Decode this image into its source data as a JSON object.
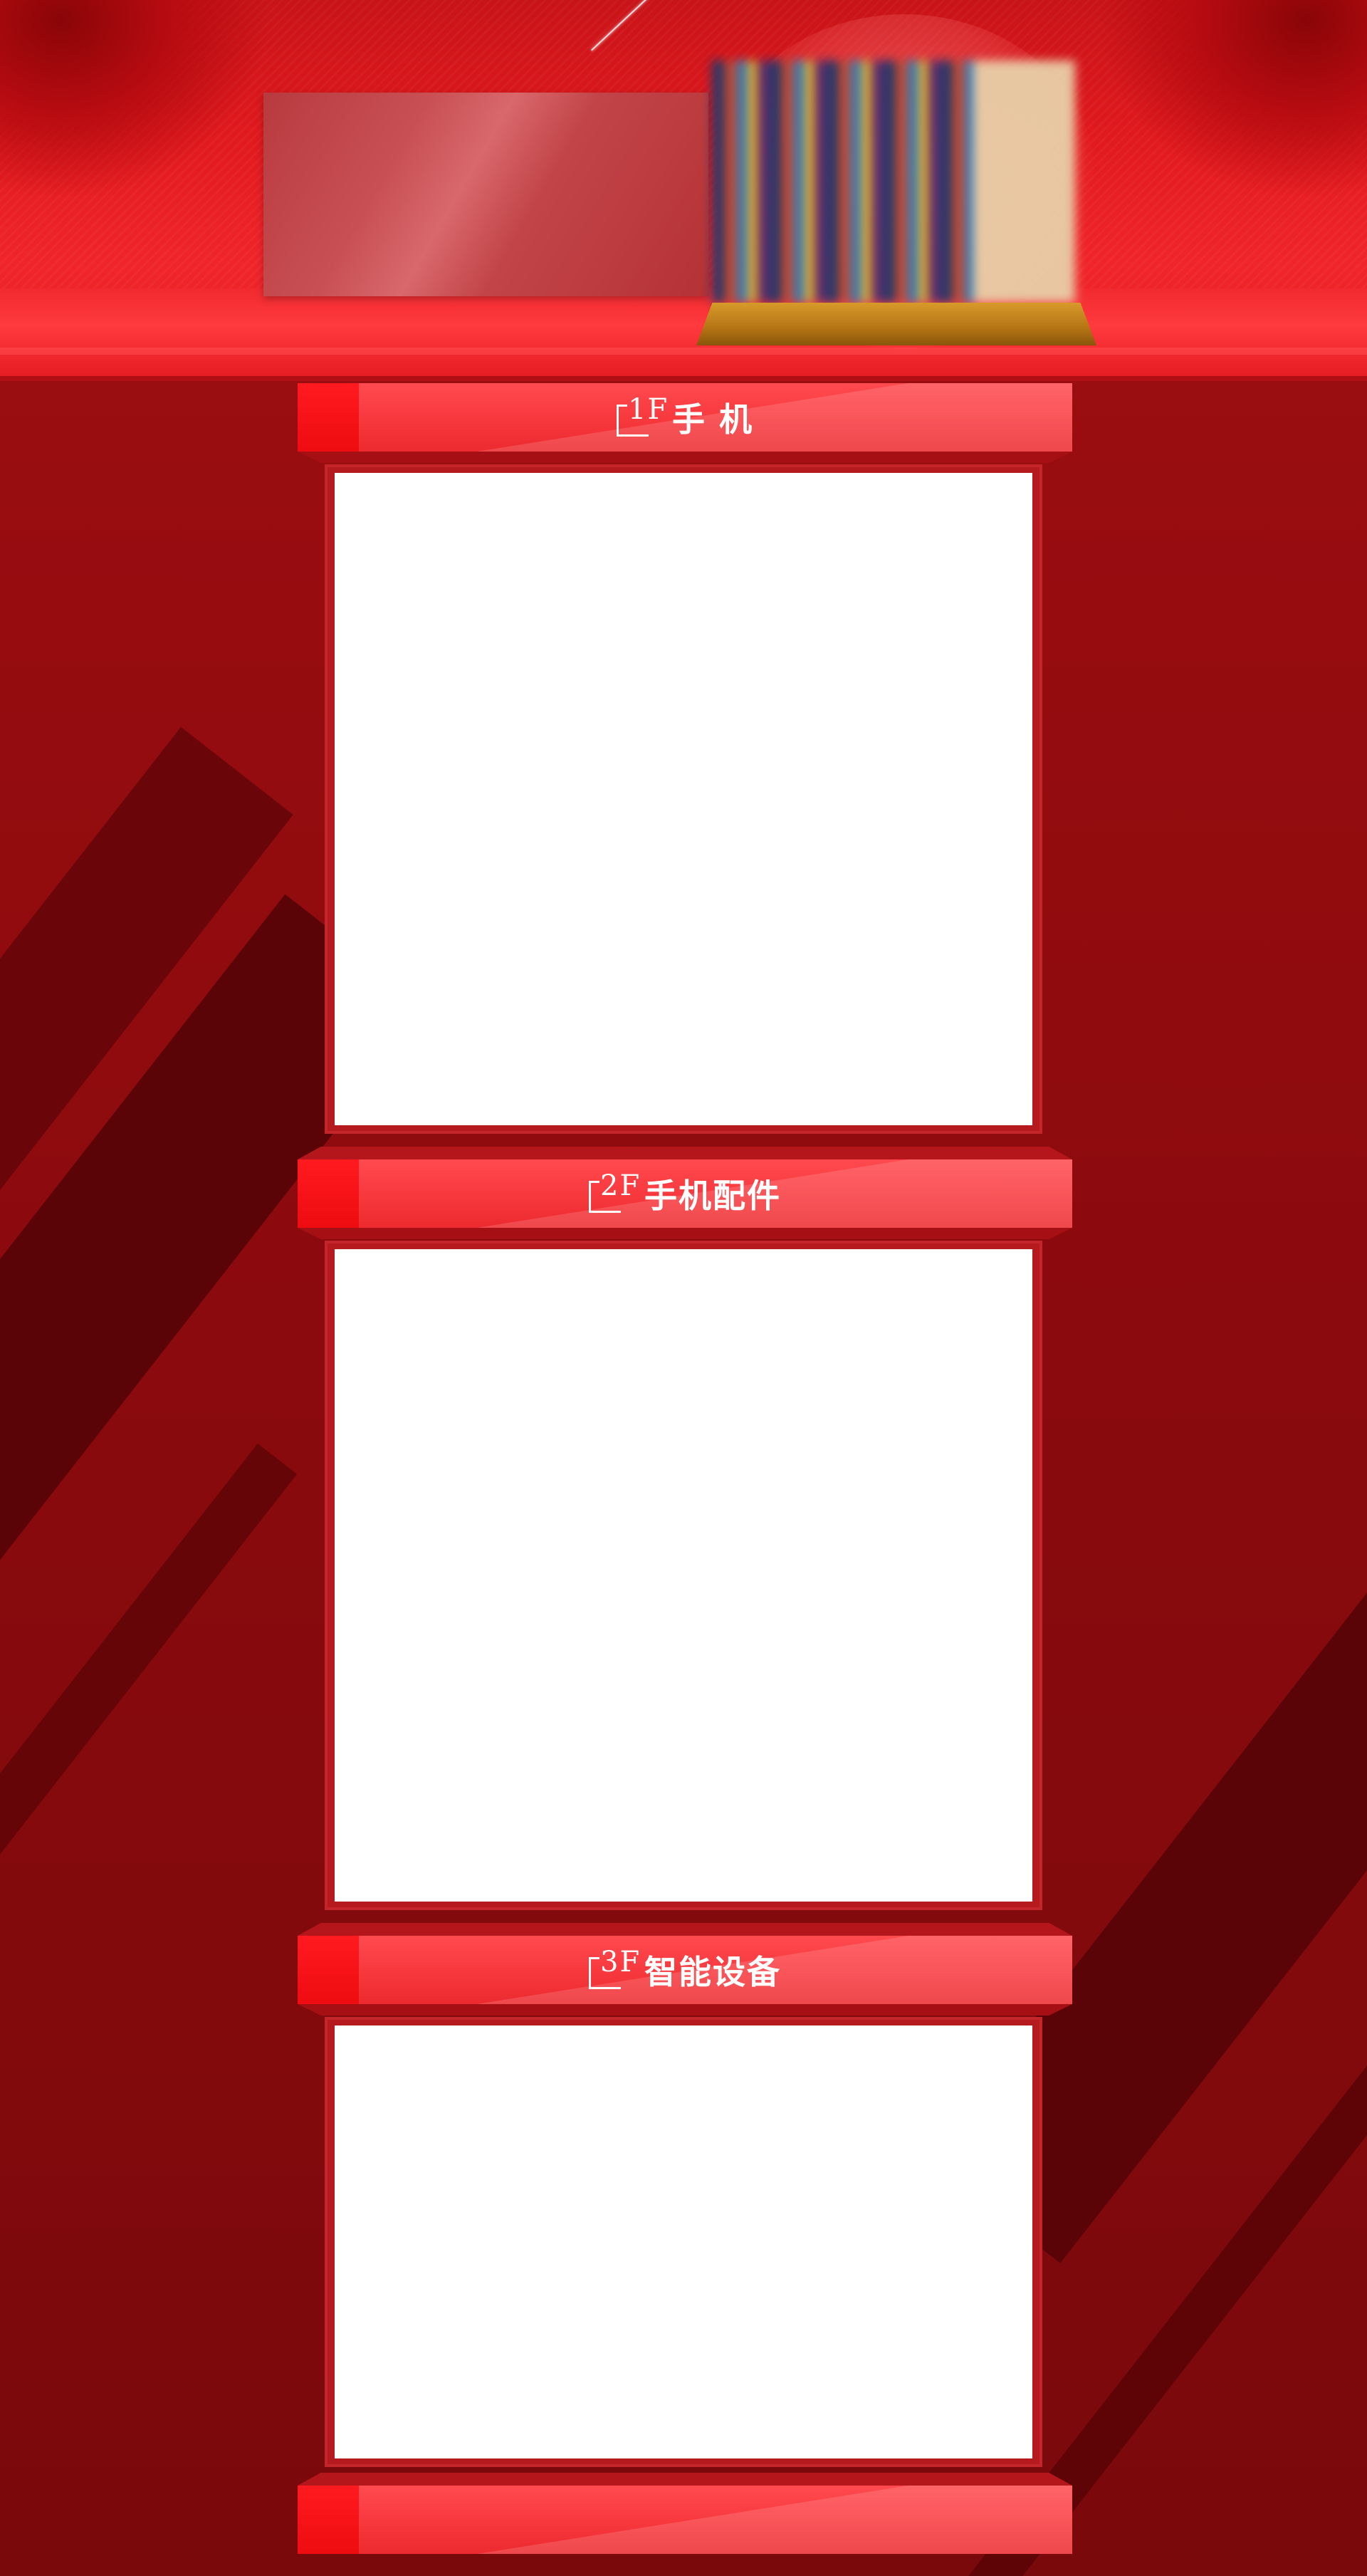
{
  "banner": {
    "panel_color": "#c24a4e",
    "product_image": "blurred-product-image",
    "accent_color": "#e51d22"
  },
  "floors": [
    {
      "number": "1",
      "suffix": "F",
      "title": "手 机"
    },
    {
      "number": "2",
      "suffix": "F",
      "title": "手机配件"
    },
    {
      "number": "3",
      "suffix": "F",
      "title": "智能设备"
    },
    {
      "number": "",
      "suffix": "",
      "title": ""
    }
  ],
  "colors": {
    "background": "#8a0b0e",
    "bar": "#f7383d",
    "bar_cap": "#ff1a1f",
    "panel": "#ffffff"
  }
}
